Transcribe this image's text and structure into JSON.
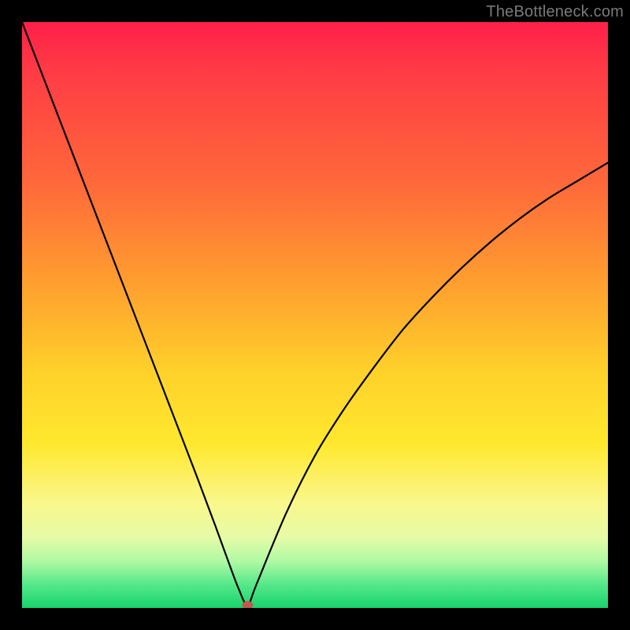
{
  "watermark": "TheBottleneck.com",
  "chart_data": {
    "type": "line",
    "title": "",
    "xlabel": "",
    "ylabel": "",
    "xlim": [
      0,
      100
    ],
    "ylim": [
      0,
      100
    ],
    "grid": false,
    "legend": false,
    "series": [
      {
        "name": "bottleneck-curve",
        "x": [
          0,
          5,
          10,
          15,
          20,
          25,
          30,
          33,
          35,
          37,
          38.5,
          40,
          45,
          50,
          55,
          60,
          65,
          70,
          75,
          80,
          85,
          90,
          95,
          100
        ],
        "values": [
          100,
          87,
          74,
          61,
          48,
          35,
          22,
          14,
          8.5,
          3.2,
          0.5,
          4.0,
          16,
          26,
          34,
          41,
          47.5,
          53,
          58,
          62.5,
          66.5,
          70,
          73,
          76
        ]
      }
    ],
    "marker": {
      "name": "optimum-point",
      "x": 38.5,
      "y": 0.5
    },
    "background_gradient": {
      "direction": "top-to-bottom",
      "stops": [
        {
          "pos": 0.0,
          "color": "#ff1f4a"
        },
        {
          "pos": 0.28,
          "color": "#ff6a3a"
        },
        {
          "pos": 0.6,
          "color": "#ffd22a"
        },
        {
          "pos": 0.82,
          "color": "#faf78b"
        },
        {
          "pos": 0.96,
          "color": "#56e88a"
        },
        {
          "pos": 1.0,
          "color": "#18d36c"
        }
      ]
    }
  }
}
